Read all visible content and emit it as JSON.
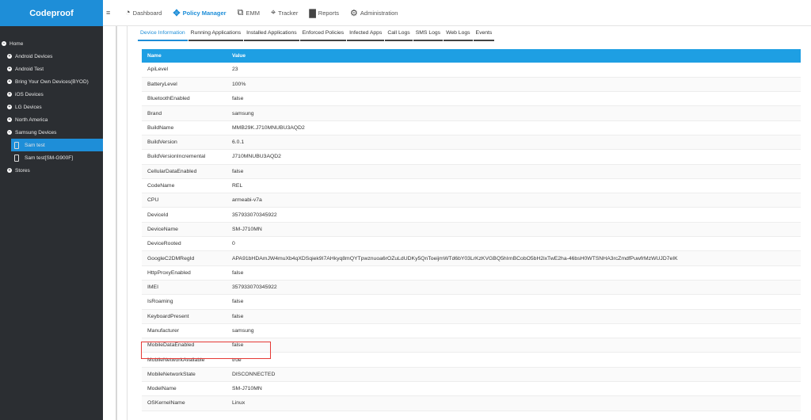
{
  "brand": "Codeproof",
  "menu_icon": "≡",
  "nav": [
    {
      "label": "Dashboard",
      "icon": "dashboard-icon",
      "glyph": "◔"
    },
    {
      "label": "Policy Manager",
      "icon": "policy-icon",
      "glyph": "✥",
      "active": true
    },
    {
      "label": "EMM",
      "icon": "emm-icon",
      "glyph": "⧉"
    },
    {
      "label": "Tracker",
      "icon": "map-pin-icon",
      "glyph": "⌖"
    },
    {
      "label": "Reports",
      "icon": "bar-chart-icon",
      "glyph": "▇"
    },
    {
      "label": "Administration",
      "icon": "gear-icon",
      "glyph": "⚙"
    }
  ],
  "tree": [
    {
      "label": "Home",
      "level": 0,
      "marker": "−"
    },
    {
      "label": "Android Devices",
      "level": 1,
      "marker": "+"
    },
    {
      "label": "Android Test",
      "level": 1,
      "marker": "+"
    },
    {
      "label": "Bring Your Own Devices(BYOD)",
      "level": 1,
      "marker": "+"
    },
    {
      "label": "iOS Devices",
      "level": 1,
      "marker": "+"
    },
    {
      "label": "LG Devices",
      "level": 1,
      "marker": "+"
    },
    {
      "label": "North America",
      "level": 1,
      "marker": "+"
    },
    {
      "label": "Samsung Devices",
      "level": 1,
      "marker": "−"
    },
    {
      "label": "Sam test",
      "level": 2,
      "selected": true
    },
    {
      "label": "Sam test[SM-G900F]",
      "level": 2
    },
    {
      "label": "Stores",
      "level": 1,
      "marker": "+"
    }
  ],
  "tabs": [
    {
      "label": "Device Information",
      "active": true
    },
    {
      "label": "Running Applications"
    },
    {
      "label": "Installed Applications"
    },
    {
      "label": "Enforced Policies"
    },
    {
      "label": "Infected Apps"
    },
    {
      "label": "Call Logs"
    },
    {
      "label": "SMS Logs"
    },
    {
      "label": "Web Logs"
    },
    {
      "label": "Events"
    }
  ],
  "table": {
    "headers": [
      "Name",
      "Value"
    ],
    "rows": [
      [
        "ApiLevel",
        "23"
      ],
      [
        "BatteryLevel",
        "100%"
      ],
      [
        "BluetoothEnabled",
        "false"
      ],
      [
        "Brand",
        "samsung"
      ],
      [
        "BuildName",
        "MMB29K.J710MNUBU3AQD2"
      ],
      [
        "BuildVersion",
        "6.0.1"
      ],
      [
        "BuildVersionIncremental",
        "J710MNUBU3AQD2"
      ],
      [
        "CellularDataEnabled",
        "false"
      ],
      [
        "CodeName",
        "REL"
      ],
      [
        "CPU",
        "armeabi-v7a"
      ],
      [
        "DeviceId",
        "357933070345922"
      ],
      [
        "DeviceName",
        "SM-J710MN"
      ],
      [
        "DeviceRooted",
        "0"
      ],
      [
        "GoogleC2DMRegId",
        "APA91bHDAmJW4muXb4qXDSqiek9I7AHkyq8mQYTpwznuoa6rOZuLdUDKy5QnToeijmWTd6bY03LrKzKVGBQ5hIrnBCobO5bH2ixTwE2ha-46bsH0WTSNHA3rcZmdfPuwfrMzWUJD7eIK"
      ],
      [
        "HttpProxyEnabled",
        "false"
      ],
      [
        "IMEI",
        "357933070345922"
      ],
      [
        "IsRoaming",
        "false"
      ],
      [
        "KeyboardPresent",
        "false"
      ],
      [
        "Manufacturer",
        "samsung"
      ],
      [
        "MobileDataEnabled",
        "false"
      ],
      [
        "MobileNetworkAvailable",
        "true"
      ],
      [
        "MobileNetworkState",
        "DISCONNECTED"
      ],
      [
        "ModelName",
        "SM-J710MN"
      ],
      [
        "OSKernelName",
        "Linux"
      ]
    ]
  },
  "highlighted_row": "MobileDataEnabled",
  "colors": {
    "accent": "#1e8ed8",
    "header": "#1e9fe3",
    "sidebar": "#2b2e32",
    "highlight": "#e53935"
  }
}
